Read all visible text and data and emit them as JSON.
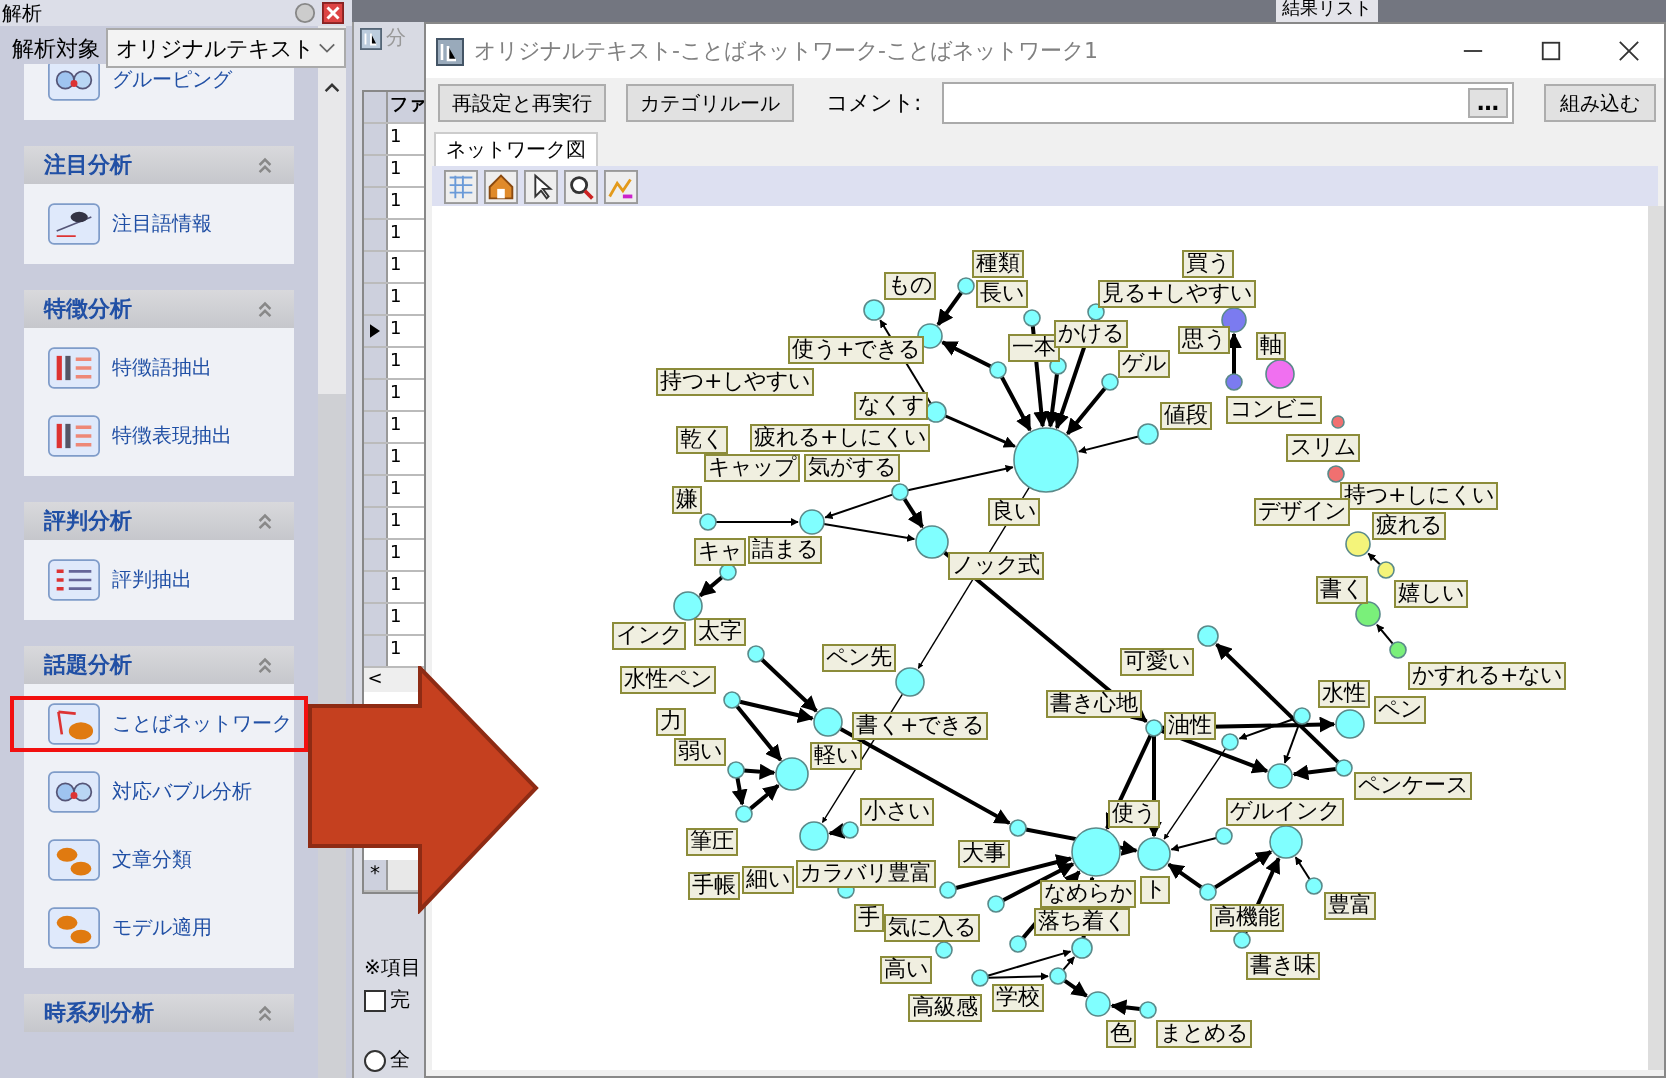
{
  "sidebar": {
    "title": "解析",
    "target_label": "解析対象",
    "target_value": "オリジナルテキスト",
    "groups": [
      {
        "items": [
          {
            "label": "グルーピング",
            "selected": false
          }
        ]
      },
      {
        "title": "注目分析",
        "items": [
          {
            "label": "注目語情報",
            "selected": false
          }
        ]
      },
      {
        "title": "特徴分析",
        "items": [
          {
            "label": "特徴語抽出",
            "selected": false
          },
          {
            "label": "特徴表現抽出",
            "selected": false
          }
        ]
      },
      {
        "title": "評判分析",
        "items": [
          {
            "label": "評判抽出",
            "selected": false
          }
        ]
      },
      {
        "title": "話題分析",
        "items": [
          {
            "label": "ことばネットワーク",
            "selected": true
          },
          {
            "label": "対応バブル分析",
            "selected": false
          },
          {
            "label": "文章分類",
            "selected": false
          },
          {
            "label": "モデル適用",
            "selected": false
          }
        ]
      },
      {
        "title": "時系列分析"
      }
    ]
  },
  "result_list": {
    "title": "結果リスト"
  },
  "middle_window": {
    "title": "分",
    "column": "ファ",
    "rows": [
      {
        "value": "1",
        "current": false
      },
      {
        "value": "1",
        "current": false
      },
      {
        "value": "1",
        "current": false
      },
      {
        "value": "1",
        "current": false
      },
      {
        "value": "1",
        "current": false
      },
      {
        "value": "1",
        "current": false
      },
      {
        "value": "1",
        "current": true
      },
      {
        "value": "1",
        "current": false
      },
      {
        "value": "1",
        "current": false
      },
      {
        "value": "1",
        "current": false
      },
      {
        "value": "1",
        "current": false
      },
      {
        "value": "1",
        "current": false
      },
      {
        "value": "1",
        "current": false
      },
      {
        "value": "1",
        "current": false
      },
      {
        "value": "1",
        "current": false
      },
      {
        "value": "1",
        "current": false
      },
      {
        "value": "1",
        "current": false
      }
    ],
    "scroll_left": "<",
    "new_row": "*",
    "note": "※項目",
    "checkbox": {
      "label": "完",
      "checked": false
    },
    "radio": {
      "label": "全",
      "selected": false
    }
  },
  "dialog": {
    "title": "オリジナルテキスト-ことばネットワーク-ことばネットワーク1",
    "buttons": [
      "再設定と再実行",
      "カテゴリルール"
    ],
    "comment_label": "コメント:",
    "more_button": "…",
    "embed_button": "組み込む",
    "tabs": [
      {
        "label": "ネットワーク図",
        "selected": true
      }
    ]
  },
  "network": {
    "nodes": [
      {
        "color": "#80ffff"
      },
      {
        "color": "#80ffff"
      },
      {
        "color": "#80ffff"
      },
      {
        "color": "#80ffff"
      },
      {
        "color": "#80ffff"
      },
      {
        "color": "#80ffff"
      },
      {
        "color": "#80ffff"
      },
      {
        "color": "#80ffff"
      },
      {
        "color": "#80ffff"
      },
      {
        "color": "#80ffff"
      },
      {
        "color": "#80ffff"
      },
      {
        "color": "#80ffff"
      },
      {
        "color": "#80ffff"
      },
      {
        "color": "#80ffff"
      },
      {
        "color": "#80ffff"
      },
      {
        "color": "#80ffff"
      },
      {
        "color": "#80ffff"
      },
      {
        "color": "#80ffff"
      },
      {
        "color": "#80ffff"
      },
      {
        "color": "#7b7bf0"
      },
      {
        "color": "#7b7bf0"
      },
      {
        "color": "#f070f0"
      },
      {
        "color": "#f07070"
      },
      {
        "color": "#f07070"
      },
      {
        "color": "#f4f47a"
      },
      {
        "color": "#f4f47a"
      },
      {
        "color": "#7af07a"
      },
      {
        "color": "#7af07a"
      },
      {
        "color": "#80ffff"
      },
      {
        "color": "#80ffff"
      },
      {
        "color": "#80ffff"
      },
      {
        "color": "#80ffff"
      },
      {
        "color": "#80ffff"
      },
      {
        "color": "#80ffff"
      },
      {
        "color": "#80ffff"
      },
      {
        "color": "#80ffff"
      },
      {
        "color": "#80ffff"
      },
      {
        "color": "#80ffff"
      },
      {
        "color": "#80ffff"
      },
      {
        "color": "#80ffff"
      },
      {
        "color": "#80ffff"
      },
      {
        "color": "#80ffff"
      },
      {
        "color": "#80ffff"
      },
      {
        "color": "#80ffff"
      },
      {
        "color": "#80ffff"
      },
      {
        "color": "#80ffff"
      },
      {
        "color": "#80ffff"
      },
      {
        "color": "#80ffff"
      },
      {
        "color": "#80ffff"
      },
      {
        "color": "#80ffff"
      },
      {
        "color": "#80ffff"
      },
      {
        "color": "#80ffff"
      },
      {
        "color": "#80ffff"
      },
      {
        "color": "#80ffff"
      },
      {
        "color": "#80ffff"
      },
      {
        "color": "#80ffff"
      },
      {
        "color": "#80ffff"
      },
      {
        "color": "#80ffff"
      },
      {
        "color": "#80ffff"
      },
      {
        "color": "#80ffff"
      }
    ],
    "labels": [
      "もの",
      "種類",
      "長い",
      "買う",
      "見る+しやすい",
      "使う+できる",
      "一本",
      "かける",
      "ゲル",
      "思う",
      "軸",
      "持つ+しやすい",
      "なくす",
      "値段",
      "コンビニ",
      "乾く",
      "疲れる+しにくい",
      "スリム",
      "キャップ",
      "気がする",
      "嫌",
      "持つ+しにくい",
      "デザイン",
      "疲れる",
      "良い",
      "キャ",
      "詰まる",
      "ノック式",
      "書く",
      "嬉しい",
      "インク",
      "太字",
      "水性ペン",
      "ペン先",
      "可愛い",
      "かすれる+ない",
      "力",
      "書く+できる",
      "書き心地",
      "油性",
      "水性",
      "ペン",
      "弱い",
      "軽い",
      "ペンケース",
      "小さい",
      "使う",
      "ゲルインク",
      "筆圧",
      "大事",
      "手帳",
      "細い",
      "カラバリ豊富",
      "手",
      "気に入る",
      "なめらか",
      "ト",
      "落ち着く",
      "高機能",
      "豊富",
      "高い",
      "書き味",
      "高級感",
      "学校",
      "色",
      "まとめる"
    ]
  }
}
